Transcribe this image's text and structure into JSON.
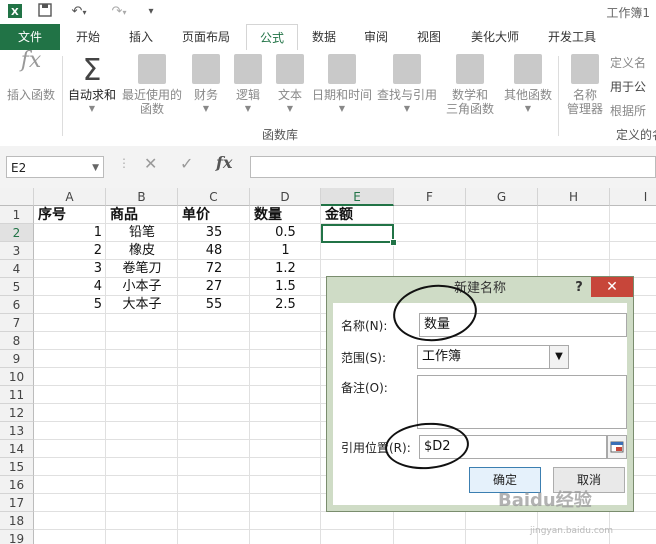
{
  "window": {
    "title": "工作簿1"
  },
  "tabs": [
    "文件",
    "开始",
    "插入",
    "页面布局",
    "公式",
    "数据",
    "审阅",
    "视图",
    "美化大师",
    "开发工具"
  ],
  "active_tab": "公式",
  "ribbon": {
    "insert_function": "插入函数",
    "autosum": "自动求和",
    "recent": [
      "最近使用的",
      "函数"
    ],
    "financial": "财务",
    "logical": "逻辑",
    "text": "文本",
    "datetime": "日期和时间",
    "lookup": "查找与引用",
    "math": [
      "数学和",
      "三角函数"
    ],
    "more": "其他函数",
    "name_manager": [
      "名称",
      "管理器"
    ],
    "define_name": "定义名",
    "use_in_formula": "用于公",
    "create_from_sel": "根据所",
    "group_library": "函数库",
    "group_names": "定义的名"
  },
  "formula_bar": {
    "name_box": "E2",
    "cancel": "✕",
    "enter": "✓",
    "fx": "fx",
    "content": ""
  },
  "sheet": {
    "columns": [
      "A",
      "B",
      "C",
      "D",
      "E",
      "F",
      "G",
      "H",
      "I"
    ],
    "selected_column": "E",
    "rows": [
      "1",
      "2",
      "3",
      "4",
      "5",
      "6",
      "7",
      "8",
      "9",
      "10",
      "11",
      "12",
      "13",
      "14",
      "15",
      "16",
      "17",
      "18",
      "19"
    ],
    "selected_row": "2",
    "headers": [
      "序号",
      "商品",
      "单价",
      "数量",
      "金额"
    ],
    "data": [
      [
        "1",
        "铅笔",
        "35",
        "0.5"
      ],
      [
        "2",
        "橡皮",
        "48",
        "1"
      ],
      [
        "3",
        "卷笔刀",
        "72",
        "1.2"
      ],
      [
        "4",
        "小本子",
        "27",
        "1.5"
      ],
      [
        "5",
        "大本子",
        "55",
        "2.5"
      ]
    ]
  },
  "dialog": {
    "title": "新建名称",
    "help": "?",
    "close": "✕",
    "name_label": "名称(N):",
    "name_value": "数量",
    "scope_label": "范围(S):",
    "scope_value": "工作簿",
    "comment_label": "备注(O):",
    "comment_value": "",
    "refers_label": "引用位置(R):",
    "refers_value": "$D2",
    "ok": "确定",
    "cancel": "取消"
  },
  "watermark": {
    "text": "Baidu经验",
    "sub": "jingyan.baidu.com"
  }
}
